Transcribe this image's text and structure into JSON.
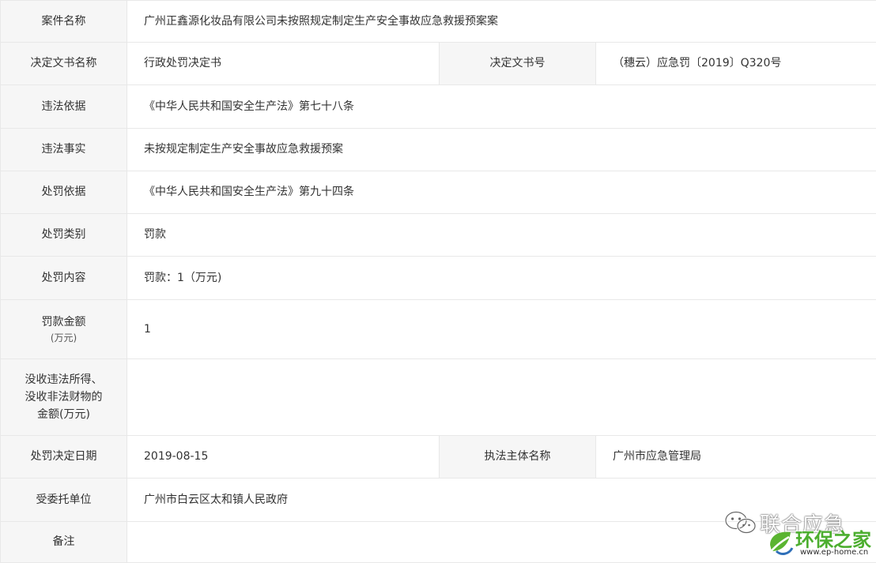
{
  "rows": [
    {
      "label": "案件名称",
      "value": "广州正鑫源化妆品有限公司未按照规定制定生产安全事故应急救援预案案"
    },
    {
      "label": "决定文书名称",
      "value": "行政处罚决定书",
      "label2": "决定文书号",
      "value2": "（穗云）应急罚〔2019〕Q320号"
    },
    {
      "label": "违法依据",
      "value": "《中华人民共和国安全生产法》第七十八条"
    },
    {
      "label": "违法事实",
      "value": "未按规定制定生产安全事故应急救援预案"
    },
    {
      "label": "处罚依据",
      "value": "《中华人民共和国安全生产法》第九十四条"
    },
    {
      "label": "处罚类别",
      "value": "罚款"
    },
    {
      "label": "处罚内容",
      "value": "罚款：1（万元)"
    },
    {
      "label": "罚款金额",
      "label_sub": "(万元)",
      "value": "1"
    },
    {
      "label_lines": [
        "没收违法所得、",
        "没收非法财物的",
        "金额(万元)"
      ],
      "value": ""
    },
    {
      "label": "处罚决定日期",
      "value": "2019-08-15",
      "label2": "执法主体名称",
      "value2": "广州市应急管理局"
    },
    {
      "label": "受委托单位",
      "value": "广州市白云区太和镇人民政府"
    },
    {
      "label": "备注",
      "value": ""
    }
  ],
  "watermarks": {
    "wechat_text": "联合应急",
    "site_name": "环保之家",
    "site_url": "www.ep-home.cn"
  }
}
